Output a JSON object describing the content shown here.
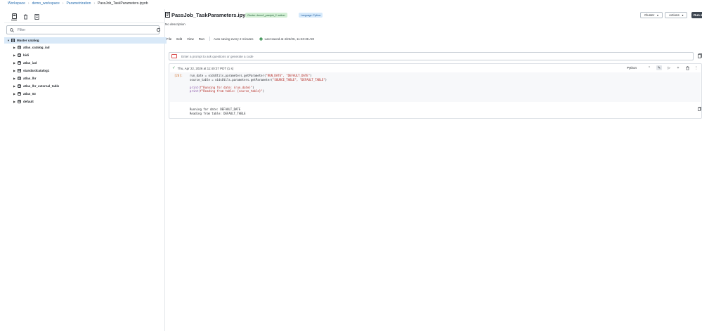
{
  "breadcrumb": {
    "items": [
      "Workspace",
      "demo_workspace",
      "Parametrization"
    ],
    "current": "PassJob_TaskParameters.ipynb"
  },
  "sidebar": {
    "filter_placeholder": "Filter",
    "root": "Master catalog",
    "items": [
      {
        "label": "atlas_catalog_iad"
      },
      {
        "label": "bidi"
      },
      {
        "label": "atlas_iad"
      },
      {
        "label": "standardcatalog1"
      },
      {
        "label": "atlas_lhr"
      },
      {
        "label": "atlas_lhr_external_table"
      },
      {
        "label": "atlas_03"
      },
      {
        "label": "default"
      }
    ]
  },
  "header": {
    "title": "PassJob_TaskParameters.ipynb",
    "cluster_badge": "Cluster: demo1_passjob_2 ‹active›",
    "language_badge": "Language: Python",
    "description": "No description",
    "cluster_button": "Cluster",
    "actions_button": "Actions",
    "run_button": "Run all"
  },
  "menu": {
    "items": [
      "File",
      "Edit",
      "View",
      "Run"
    ],
    "autosave": "Auto saving every 2 minutes",
    "last_saved": "Last saved at 4/22/26, 11:40:36 AM"
  },
  "prompt": {
    "placeholder": "Enter a prompt to ask questions or generate a code"
  },
  "cell": {
    "status": "Thu, Apr 22, 2026 at 11:40:37 PDT (1 s)",
    "language": "Python",
    "exec_count": "[26]:",
    "code_lines": [
      {
        "pre": "run_date = oidsUtils.parameters.getParameter(",
        "str": "\"RUN_DATE\", \"DEFAULT_DATE\"",
        "post": ")"
      },
      {
        "pre": "source_table = oidsUtils.parameters.getParameter(",
        "str": "\"SOURCE_TABLE\", \"DEFAULT_TABLE\"",
        "post": ")"
      },
      {
        "pre": "",
        "str": "",
        "post": ""
      },
      {
        "pre": "print(",
        "str": "f\"Running for date: {run_date}\"",
        "post": ")"
      },
      {
        "pre": "print(",
        "str": "f\"Reading from table: {source_table}\"",
        "post": ")"
      }
    ],
    "output_lines": [
      "Running for date: DEFAULT_DATE",
      "Reading from table: DEFAULT_TABLE"
    ]
  },
  "colors": {
    "accent": "#2a6fb0",
    "selected_row": "#d9e9f8",
    "success": "#2e8b47",
    "run_button": "#3e4650"
  }
}
